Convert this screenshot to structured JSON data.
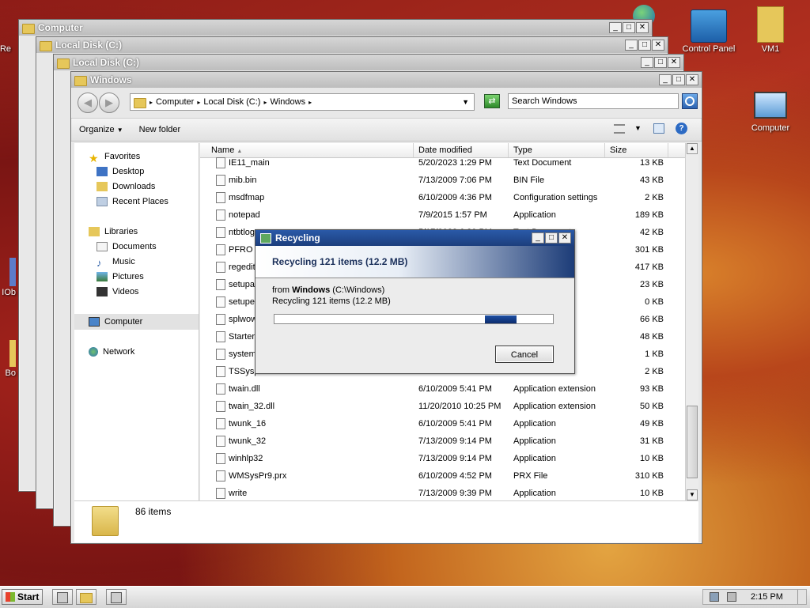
{
  "desktop": {
    "icons": [
      {
        "label": "Control Panel"
      },
      {
        "label": "VM1"
      },
      {
        "label": "Computer"
      },
      {
        "label": "Re"
      },
      {
        "label": "IOb"
      },
      {
        "label": "Bo"
      }
    ]
  },
  "bg_windows": [
    {
      "title": "Computer"
    },
    {
      "title": "Local Disk (C:)"
    },
    {
      "title": "Local Disk (C:)"
    }
  ],
  "main_window": {
    "title": "Windows",
    "address": {
      "seg1": "Computer",
      "seg2": "Local Disk (C:)",
      "seg3": "Windows"
    },
    "search_placeholder": "Search Windows",
    "toolbar": {
      "organize": "Organize",
      "new_folder": "New folder"
    },
    "nav": {
      "favorites": "Favorites",
      "desktop": "Desktop",
      "downloads": "Downloads",
      "recent": "Recent Places",
      "libraries": "Libraries",
      "documents": "Documents",
      "music": "Music",
      "pictures": "Pictures",
      "videos": "Videos",
      "computer": "Computer",
      "network": "Network"
    },
    "columns": {
      "name": "Name",
      "date": "Date modified",
      "type": "Type",
      "size": "Size"
    },
    "files": [
      {
        "name": "IE11_main",
        "date": "5/20/2023 1:29 PM",
        "type": "Text Document",
        "size": "13 KB"
      },
      {
        "name": "mib.bin",
        "date": "7/13/2009 7:06 PM",
        "type": "BIN File",
        "size": "43 KB"
      },
      {
        "name": "msdfmap",
        "date": "6/10/2009 4:36 PM",
        "type": "Configuration settings",
        "size": "2 KB"
      },
      {
        "name": "notepad",
        "date": "7/9/2015 1:57 PM",
        "type": "Application",
        "size": "189 KB"
      },
      {
        "name": "ntbtlog",
        "date": "5/17/2023 6:20 PM",
        "type": "Text Document",
        "size": "42 KB"
      },
      {
        "name": "PFRO",
        "date": "",
        "type": "",
        "size": "301 KB"
      },
      {
        "name": "regedit",
        "date": "",
        "type": "",
        "size": "417 KB"
      },
      {
        "name": "setupa",
        "date": "",
        "type": "",
        "size": "23 KB"
      },
      {
        "name": "setupe",
        "date": "",
        "type": "",
        "size": "0 KB"
      },
      {
        "name": "splwow",
        "date": "",
        "type": "",
        "size": "66 KB"
      },
      {
        "name": "Starter",
        "date": "",
        "type": "",
        "size": "48 KB"
      },
      {
        "name": "system",
        "date": "",
        "type": "ttings",
        "size": "1 KB"
      },
      {
        "name": "TSSysp",
        "date": "",
        "type": "",
        "size": "2 KB"
      },
      {
        "name": "twain.dll",
        "date": "6/10/2009 5:41 PM",
        "type": "Application extension",
        "size": "93 KB"
      },
      {
        "name": "twain_32.dll",
        "date": "11/20/2010 10:25 PM",
        "type": "Application extension",
        "size": "50 KB"
      },
      {
        "name": "twunk_16",
        "date": "6/10/2009 5:41 PM",
        "type": "Application",
        "size": "49 KB"
      },
      {
        "name": "twunk_32",
        "date": "7/13/2009 9:14 PM",
        "type": "Application",
        "size": "31 KB"
      },
      {
        "name": "winhlp32",
        "date": "7/13/2009 9:14 PM",
        "type": "Application",
        "size": "10 KB"
      },
      {
        "name": "WMSysPr9.prx",
        "date": "6/10/2009 4:52 PM",
        "type": "PRX File",
        "size": "310 KB"
      },
      {
        "name": "write",
        "date": "7/13/2009 9:39 PM",
        "type": "Application",
        "size": "10 KB"
      }
    ],
    "status": "86 items"
  },
  "dialog": {
    "title": "Recycling",
    "heading": "Recycling 121 items (12.2 MB)",
    "from_prefix": "from ",
    "from_bold": "Windows",
    "from_path": " (C:\\Windows)",
    "detail": "Recycling 121 items (12.2 MB)",
    "cancel": "Cancel"
  },
  "taskbar": {
    "start": "Start",
    "clock": "2:15 PM"
  }
}
